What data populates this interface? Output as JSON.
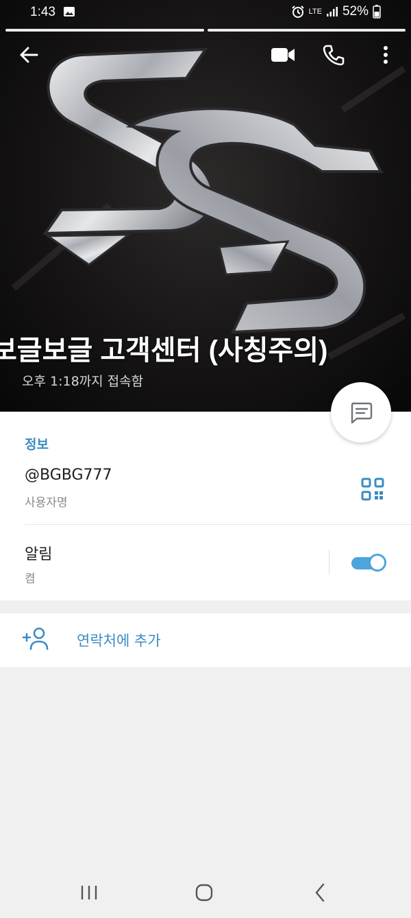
{
  "status_bar": {
    "time": "1:43",
    "network": "LTE",
    "battery": "52%"
  },
  "story_progress": {
    "segments": 2,
    "active_index": 1
  },
  "profile": {
    "name": "보글보글 고객센터 (사칭주의)",
    "last_seen": "오후 1:18까지 접속함",
    "photo_icon": "silver-ss-logo"
  },
  "info": {
    "section_title": "정보",
    "username": "@BGBG777",
    "username_label": "사용자명",
    "notifications_label": "알림",
    "notifications_value": "켬",
    "notifications_on": true
  },
  "actions": {
    "add_contact": "연락처에 추가"
  },
  "colors": {
    "accent": "#3a8bc3",
    "toggle": "#4ea4dc",
    "background": "#f0f0f0"
  },
  "icons": {
    "back": "arrow-left-icon",
    "video": "video-call-icon",
    "call": "phone-icon",
    "more": "more-vertical-icon",
    "message": "message-icon",
    "qr": "qr-code-icon",
    "add_contact": "add-user-icon"
  }
}
